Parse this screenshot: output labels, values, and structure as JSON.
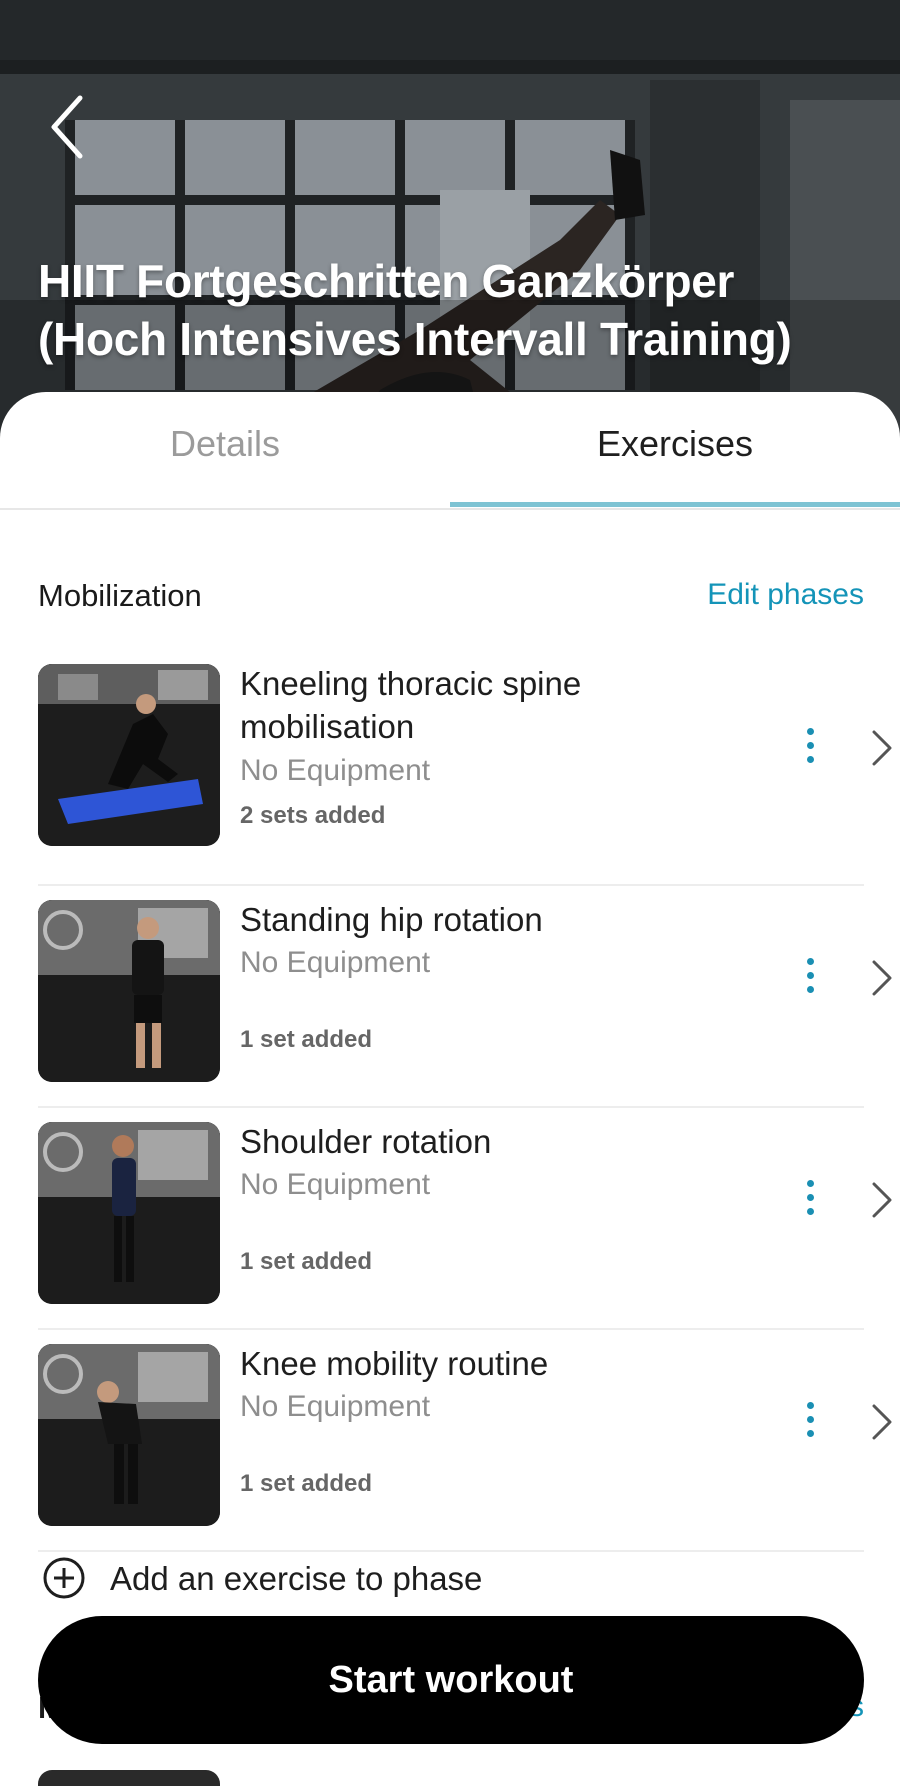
{
  "header": {
    "title_line1": "HIIT Fortgeschritten Ganzkörper",
    "title_line2": "(Hoch Intensives Intervall Training)"
  },
  "tabs": [
    {
      "label": "Details",
      "active": false
    },
    {
      "label": "Exercises",
      "active": true
    }
  ],
  "phase": {
    "title": "Mobilization",
    "edit_label": "Edit phases"
  },
  "exercises": [
    {
      "name": "Kneeling thoracic spine mobilisation",
      "equipment": "No Equipment",
      "sets": "2 sets added"
    },
    {
      "name": "Standing hip rotation",
      "equipment": "No Equipment",
      "sets": "1 set added"
    },
    {
      "name": "Shoulder rotation",
      "equipment": "No Equipment",
      "sets": "1 set added"
    },
    {
      "name": "Knee mobility routine",
      "equipment": "No Equipment",
      "sets": "1 set added"
    }
  ],
  "add_exercise_label": "Add an exercise to phase",
  "next_phase": {
    "title_peek": "M",
    "edit_peek": "s"
  },
  "start_button_label": "Start workout",
  "colors": {
    "accent": "#1494b8",
    "tab_underline": "#7ec3d3",
    "start_button": "#000000"
  },
  "icons": {
    "back": "chevron-left-icon",
    "more": "kebab-vertical-icon",
    "open": "chevron-right-icon",
    "add": "plus-circle-icon"
  }
}
